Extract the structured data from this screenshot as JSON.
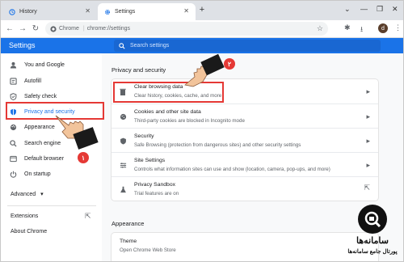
{
  "tabs": [
    {
      "label": "History",
      "icon": "history-icon"
    },
    {
      "label": "Settings",
      "icon": "gear-icon"
    }
  ],
  "toolbar": {
    "site_label": "Chrome",
    "url": "chrome://settings"
  },
  "avatar_letter": "d",
  "header": {
    "title": "Settings",
    "search_placeholder": "Search settings"
  },
  "sidebar": {
    "items": [
      {
        "label": "You and Google",
        "icon": "person-icon"
      },
      {
        "label": "Autofill",
        "icon": "autofill-icon"
      },
      {
        "label": "Safety check",
        "icon": "shield-check-icon"
      },
      {
        "label": "Privacy and security",
        "icon": "shield-icon"
      },
      {
        "label": "Appearance",
        "icon": "palette-icon"
      },
      {
        "label": "Search engine",
        "icon": "search-icon"
      },
      {
        "label": "Default browser",
        "icon": "browser-icon"
      },
      {
        "label": "On startup",
        "icon": "power-icon"
      }
    ],
    "advanced": "Advanced",
    "extensions": "Extensions",
    "about": "About Chrome"
  },
  "main": {
    "section_title": "Privacy and security",
    "rows": [
      {
        "title": "Clear browsing data",
        "subtitle": "Clear history, cookies, cache, and more",
        "icon": "trash-icon"
      },
      {
        "title": "Cookies and other site data",
        "subtitle": "Third-party cookies are blocked in Incognito mode",
        "icon": "cookie-icon"
      },
      {
        "title": "Security",
        "subtitle": "Safe Browsing (protection from dangerous sites) and other security settings",
        "icon": "security-shield-icon"
      },
      {
        "title": "Site Settings",
        "subtitle": "Controls what information sites can use and show (location, camera, pop-ups, and more)",
        "icon": "sliders-icon"
      },
      {
        "title": "Privacy Sandbox",
        "subtitle": "Trial features are on",
        "icon": "flask-icon"
      }
    ],
    "appearance_title": "Appearance",
    "theme_title": "Theme",
    "theme_subtitle": "Open Chrome Web Store"
  },
  "annotations": {
    "badge1": "١",
    "badge2": "٢"
  },
  "watermark": {
    "brand_title": "سامانه‌ها",
    "brand_subtitle": "پورتال جامع سامانه‌ها"
  },
  "colors": {
    "accent": "#1a73e8",
    "highlight": "#e53935"
  }
}
